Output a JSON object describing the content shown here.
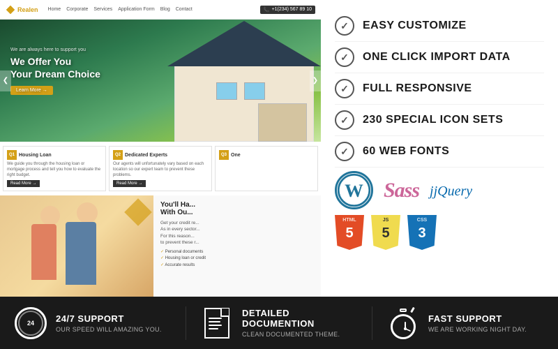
{
  "site": {
    "name": "Realen",
    "nav_links": [
      "Home",
      "Corporate",
      "Services",
      "Application Form",
      "Blog",
      "Contact"
    ],
    "phone": "+1(234) 567 89 10"
  },
  "hero": {
    "headline_1": "We Offer You",
    "headline_2": "Your Dream Choice",
    "subtext": "We are always here to support you",
    "cta": "Learn More →",
    "left_arrow": "❮",
    "right_arrow": "❯"
  },
  "cards": [
    {
      "icon": "Q1",
      "title": "Housing Loan",
      "text": "We guide you through the housing loan or mortgage process and tell you how to evaluate the right budget.",
      "btn": "Read More →"
    },
    {
      "icon": "Q2",
      "title": "Dedicated Experts",
      "text": "Our agents will unfortunately vary based on each location so our expert team to prevent these problems.",
      "btn": "Read More →"
    },
    {
      "icon": "Q3",
      "title": "One",
      "text": "",
      "btn": ""
    }
  ],
  "lower_section": {
    "title": "You'll Ha... With Ou...",
    "desc": "Get your credit re... As in every sector, the... sector in Unfortun... For this reason... credibility by ou... to prevent these r...",
    "features": [
      "Personal documents",
      "Housing loan or credit",
      "Accurate results"
    ]
  },
  "features": [
    {
      "label": "EASY CUSTOMIZE"
    },
    {
      "label": "ONE CLICK IMPORT DATA"
    },
    {
      "label": "FULL RESPONSIVE"
    },
    {
      "label": "230 SPECIAL ICON SETS"
    },
    {
      "label": "60 WEB FONTS"
    }
  ],
  "tech": {
    "wordpress_symbol": "W",
    "sass_label": "Sass",
    "jquery_label": "jQuery",
    "badges": [
      {
        "name": "HTML",
        "number": "5",
        "color": "#e34c26"
      },
      {
        "name": "JS",
        "number": "5",
        "color": "#f0db4f",
        "text_color": "#323330"
      },
      {
        "name": "CSS",
        "number": "3",
        "color": "#1572b6"
      }
    ]
  },
  "bottom_bar": [
    {
      "icon_type": "clock",
      "title": "24/7 SUPPORT",
      "subtitle": "OUR SPEED WILL AMAZING YOU."
    },
    {
      "icon_type": "document",
      "title": "DETAILED DOCUMENTION",
      "subtitle": "CLEAN DOCUMENTED THEME."
    },
    {
      "icon_type": "stopwatch",
      "title": "FAST SUPPORT",
      "subtitle": "WE ARE WORKING NIGHT DAY."
    }
  ]
}
